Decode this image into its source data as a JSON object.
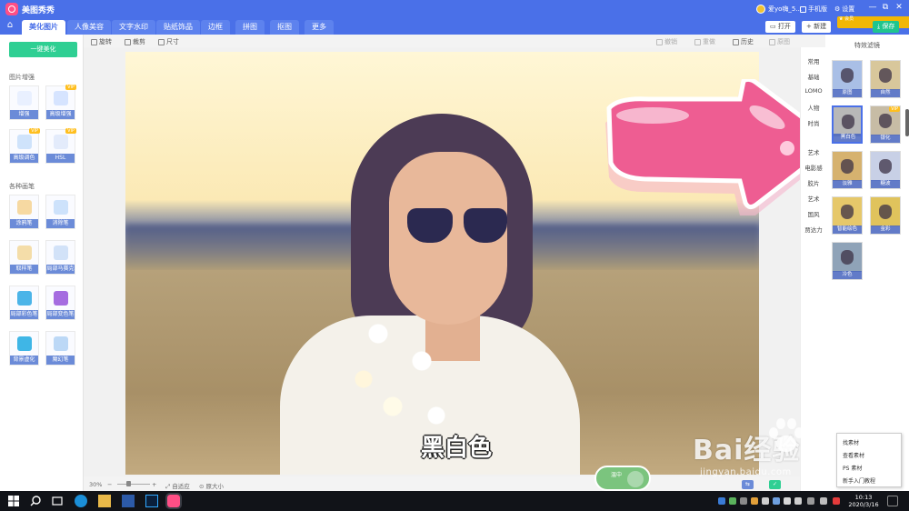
{
  "app": {
    "title": "美图秀秀"
  },
  "titlebar": {
    "username": "爱yo嗨_5...",
    "mobile": "手机版",
    "settings": "设置",
    "minimize": "—",
    "restore": "⧉",
    "close": "✕"
  },
  "tabs": [
    "美化图片",
    "人像美容",
    "文字水印",
    "贴纸饰品",
    "边框",
    "拼图",
    "抠图",
    "更多"
  ],
  "header_buttons": {
    "open": "打开",
    "new": "新建",
    "vip": "会员",
    "save": "保存"
  },
  "left_panel": {
    "one_click": "一键美化",
    "section1": "图片增强",
    "tools1": [
      {
        "label": "增强",
        "vip": false,
        "color": "#8fb3ff"
      },
      {
        "label": "高级增强",
        "vip": true,
        "color": "#6a9cf2"
      },
      {
        "label": "高级调色",
        "vip": true,
        "color": "#79b6f0"
      },
      {
        "label": "HSL",
        "vip": true,
        "color": "#8eb0ea"
      }
    ],
    "section2": "各种画笔",
    "tools2": [
      {
        "label": "涂鸦笔",
        "color": "#d9a44b"
      },
      {
        "label": "消除笔",
        "color": "#7fb4ea"
      },
      {
        "label": "取样笔",
        "color": "#e6b95a"
      },
      {
        "label": "局部马赛克",
        "color": "#6aa2e6"
      },
      {
        "label": "局部彩色笔",
        "color": "#4bb4e8"
      },
      {
        "label": "局部变色笔",
        "color": "#a56ce0"
      },
      {
        "label": "背景虚化",
        "color": "#3fb6e6"
      },
      {
        "label": "魔幻笔",
        "color": "#5fa0e6"
      }
    ],
    "vip_badge": "VIP"
  },
  "canvas_toolbar": {
    "rotate": "旋转",
    "crop": "裁剪",
    "size": "尺寸",
    "undo": "撤销",
    "redo": "重做",
    "history": "历史",
    "original": "原图"
  },
  "photo": {
    "caption": "黑白色"
  },
  "statusbar": {
    "zoom": "30%",
    "minus": "−",
    "plus": "+",
    "fit": "自适应",
    "actual": "原大小",
    "green_badge": "温中"
  },
  "right_categories": [
    "常用",
    "基础",
    "LOMO",
    "人物",
    "时尚",
    "艺术",
    "电影感",
    "胶片",
    "艺术",
    "国风",
    "贾达力"
  ],
  "filters_panel": {
    "title": "特效滤镜",
    "filters": [
      {
        "label": "原图",
        "vip": false,
        "tint": "#a9bfe6",
        "selected": false
      },
      {
        "label": "自然",
        "vip": false,
        "tint": "#d8c79b",
        "selected": false
      },
      {
        "label": "黑白色",
        "vip": false,
        "tint": "#b8b8b8",
        "selected": true
      },
      {
        "label": "银化",
        "vip": true,
        "tint": "#c7bca5",
        "selected": false
      },
      {
        "label": "淡雅",
        "vip": false,
        "tint": "#d6b26f",
        "selected": false
      },
      {
        "label": "糖波",
        "vip": false,
        "tint": "#c8d0e6",
        "selected": false
      },
      {
        "label": "智能绘色",
        "vip": false,
        "tint": "#e6c86a",
        "selected": false
      },
      {
        "label": "金彩",
        "vip": false,
        "tint": "#e0c35c",
        "selected": false
      },
      {
        "label": "冷色",
        "vip": false,
        "tint": "#8fa3b8",
        "selected": false
      }
    ]
  },
  "context_menu": [
    "找素材",
    "查看素材",
    "PS 素材",
    "新手入门教程"
  ],
  "watermark": {
    "brand": "Bai经验",
    "url": "jingyan.baidu.com"
  },
  "taskbar": {
    "time": "10:13",
    "date": "2020/3/16"
  },
  "colors": {
    "brand_blue": "#4a70e8",
    "accent_green": "#2fcf93",
    "vip_gold": "#ffbf1f",
    "arrow_pink": "#ee5d92"
  }
}
